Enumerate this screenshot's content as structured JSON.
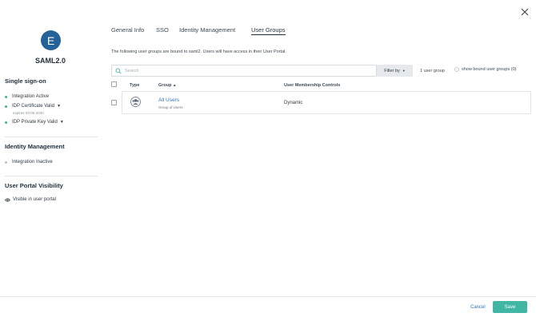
{
  "app": {
    "avatar_letter": "E",
    "name": "SAML2.0"
  },
  "sidebar": {
    "sso_heading": "Single sign-on",
    "sso_items": [
      {
        "label": "Integration Active",
        "status": "green"
      },
      {
        "label": "IDP Certificate Valid",
        "status": "green",
        "subtext": "expires 03-05-2030"
      },
      {
        "label": "IDP Private Key Valid",
        "status": "green"
      }
    ],
    "identity_heading": "Identity Management",
    "identity_items": [
      {
        "label": "Integration Inactive",
        "status": "gray"
      }
    ],
    "portal_heading": "User Portal Visibility",
    "portal_item": "Visible in user portal"
  },
  "tabs": [
    {
      "label": "General Info",
      "active": false
    },
    {
      "label": "SSO",
      "active": false
    },
    {
      "label": "Identity Management",
      "active": false
    },
    {
      "label": "User Groups",
      "active": true
    }
  ],
  "main": {
    "description": "The following user groups are bound to saml2. Users will have access in their User Portal.",
    "search_placeholder": "Search",
    "search_value": "",
    "filter_label": "Filter by",
    "count_label": "1 user group",
    "show_bound_label": "show bound user groups (0)",
    "columns": {
      "type": "Type",
      "group": "Group",
      "membership": "User Membership Controls"
    },
    "rows": [
      {
        "group_name": "All Users",
        "group_type": "Group of Users",
        "membership": "Dynamic"
      }
    ]
  },
  "footer": {
    "cancel_label": "Cancel",
    "save_label": "Save"
  },
  "colors": {
    "accent": "#41b6a4",
    "avatar": "#24629a",
    "link": "#2f72b8",
    "status_active": "#38b29e",
    "status_inactive": "#b9bfc6"
  },
  "icons": {
    "close": "close-icon",
    "search": "search-icon",
    "group": "group-icon",
    "eye": "eye-icon",
    "caret": "caret-down-icon",
    "sort": "sort-up-icon"
  }
}
